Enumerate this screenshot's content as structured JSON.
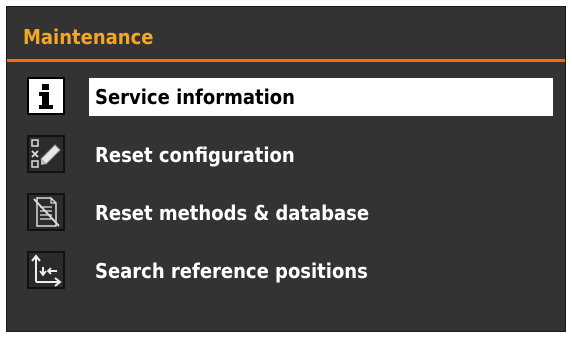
{
  "header": {
    "title": "Maintenance"
  },
  "menu": {
    "items": [
      {
        "label": "Service information",
        "icon": "info-icon",
        "selected": true
      },
      {
        "label": "Reset configuration",
        "icon": "reset-config-icon",
        "selected": false
      },
      {
        "label": "Reset methods & database",
        "icon": "reset-methods-icon",
        "selected": false
      },
      {
        "label": "Search reference positions",
        "icon": "search-reference-icon",
        "selected": false
      }
    ]
  },
  "colors": {
    "title": "#f5a623",
    "rule": "#ff6a00",
    "background": "#333333",
    "selected_bg": "#ffffff"
  }
}
